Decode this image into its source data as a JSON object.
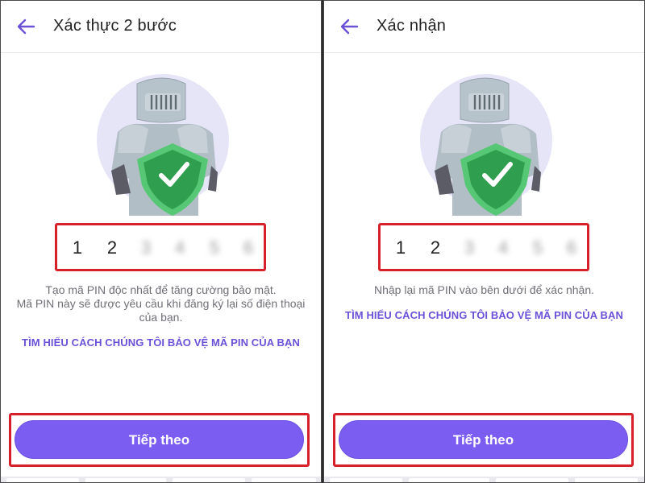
{
  "left": {
    "title": "Xác thực 2 bước",
    "pin": [
      "1",
      "2",
      "3",
      "4",
      "5",
      "6"
    ],
    "description": [
      "Tạo mã PIN độc nhất để tăng cường bảo mật.",
      "Mã PIN này sẽ được yêu cầu khi đăng ký lại số điện thoại",
      "của bạn."
    ],
    "learn_link": "TÌM HIỂU CÁCH CHÚNG TÔI BẢO VỆ MÃ PIN CỦA BẠN",
    "next_button": "Tiếp theo"
  },
  "right": {
    "title": "Xác nhận",
    "pin": [
      "1",
      "2",
      "3",
      "4",
      "5",
      "6"
    ],
    "description": [
      "Nhập lại mã PIN vào bên dưới để xác nhận."
    ],
    "learn_link": "TÌM HIỂU CÁCH CHÚNG TÔI BẢO VỆ MÃ PIN CỦA BẠN",
    "next_button": "Tiếp theo"
  },
  "colors": {
    "accent": "#7b5df2",
    "link": "#6b50d8",
    "highlight_border": "#d8202a",
    "shield": "#3fae5a"
  },
  "icons": {
    "back": "arrow-left-icon",
    "illustration": "knight-shield-illustration",
    "shield": "shield-check-icon"
  }
}
